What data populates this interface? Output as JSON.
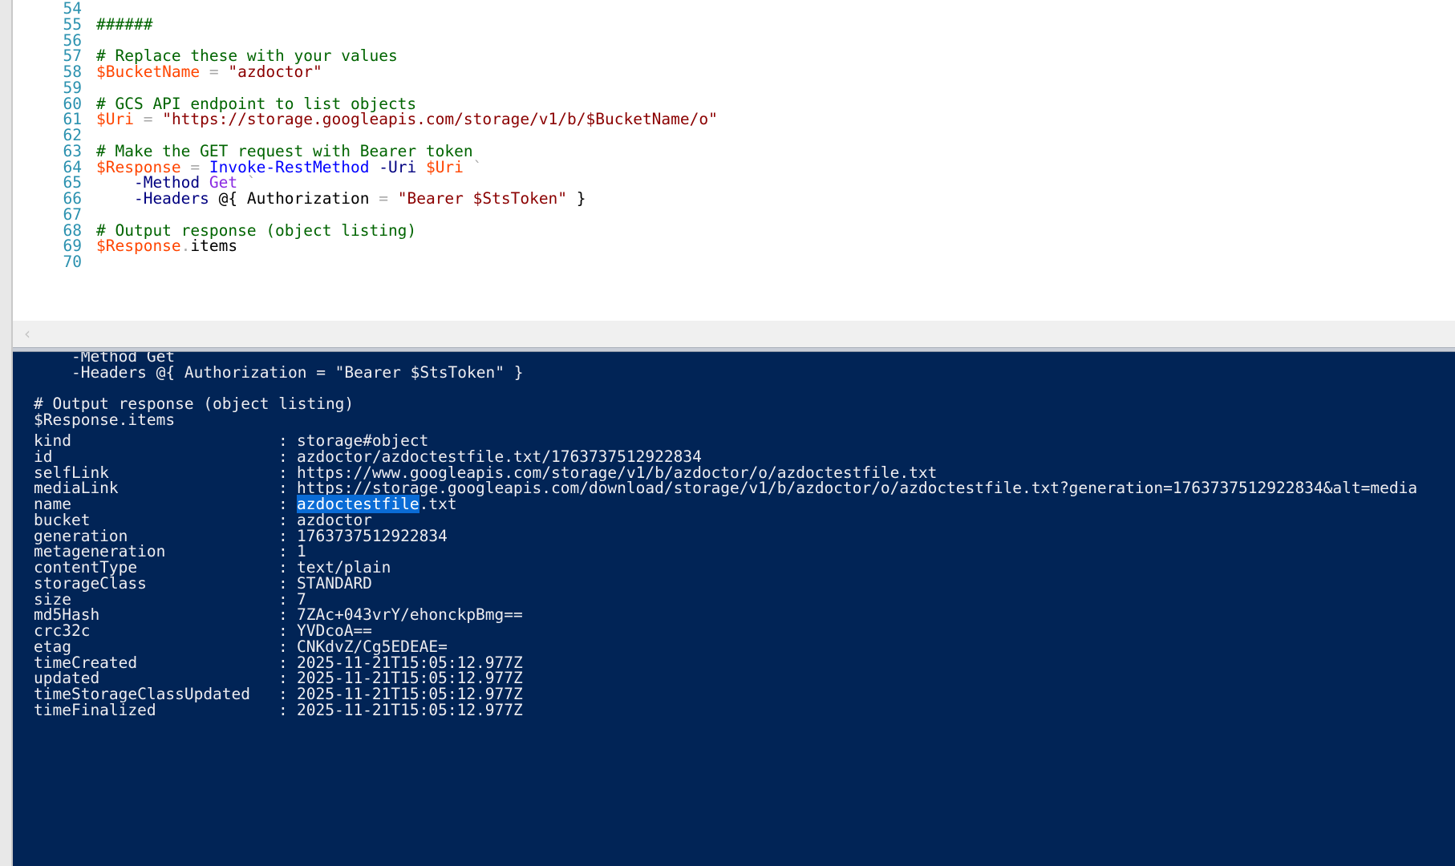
{
  "editor": {
    "line_numbers": [
      "54",
      "55",
      "56",
      "57",
      "58",
      "59",
      "60",
      "61",
      "62",
      "63",
      "64",
      "65",
      "66",
      "67",
      "68",
      "69",
      "70"
    ],
    "lines": [
      [],
      [
        {
          "t": "######",
          "c": "comment"
        }
      ],
      [],
      [
        {
          "t": "# Replace these with your values",
          "c": "comment"
        }
      ],
      [
        {
          "t": "$BucketName",
          "c": "var"
        },
        {
          "t": " = ",
          "c": "op"
        },
        {
          "t": "\"azdoctor\"",
          "c": "string"
        }
      ],
      [],
      [
        {
          "t": "# GCS API endpoint to list objects",
          "c": "comment"
        }
      ],
      [
        {
          "t": "$Uri",
          "c": "var"
        },
        {
          "t": " = ",
          "c": "op"
        },
        {
          "t": "\"https://storage.googleapis.com/storage/v1/b/$BucketName/o\"",
          "c": "string"
        }
      ],
      [],
      [
        {
          "t": "# Make the GET request with Bearer token",
          "c": "comment"
        }
      ],
      [
        {
          "t": "$Response",
          "c": "var"
        },
        {
          "t": " = ",
          "c": "op"
        },
        {
          "t": "Invoke-RestMethod",
          "c": "cmd"
        },
        {
          "t": " -Uri ",
          "c": "param"
        },
        {
          "t": "$Uri",
          "c": "var"
        },
        {
          "t": " `",
          "c": "op"
        }
      ],
      [
        {
          "t": "    -Method ",
          "c": "param"
        },
        {
          "t": "Get",
          "c": "keyword"
        },
        {
          "t": " `",
          "c": "op"
        }
      ],
      [
        {
          "t": "    -Headers ",
          "c": "param"
        },
        {
          "t": "@{ Authorization ",
          "c": "plain"
        },
        {
          "t": "=",
          "c": "op"
        },
        {
          "t": " ",
          "c": "plain"
        },
        {
          "t": "\"Bearer $StsToken\"",
          "c": "string"
        },
        {
          "t": " }",
          "c": "plain"
        }
      ],
      [],
      [
        {
          "t": "# Output response (object listing)",
          "c": "comment"
        }
      ],
      [
        {
          "t": "$Response",
          "c": "var"
        },
        {
          "t": ".",
          "c": "op"
        },
        {
          "t": "items",
          "c": "plain"
        }
      ],
      []
    ]
  },
  "console": {
    "echo_lines": [
      "    -Method Get `",
      "    -Headers @{ Authorization = \"Bearer $StsToken\" }",
      "",
      "# Output response (object listing)",
      "$Response.items"
    ],
    "properties": [
      {
        "name": "kind",
        "value": "storage#object"
      },
      {
        "name": "id",
        "value": "azdoctor/azdoctestfile.txt/1763737512922834"
      },
      {
        "name": "selfLink",
        "value": "https://www.googleapis.com/storage/v1/b/azdoctor/o/azdoctestfile.txt"
      },
      {
        "name": "mediaLink",
        "value": "https://storage.googleapis.com/download/storage/v1/b/azdoctor/o/azdoctestfile.txt?generation=1763737512922834&alt=media"
      },
      {
        "name": "name",
        "value": "azdoctestfile.txt",
        "selected": "azdoctestfile",
        "rest": ".txt"
      },
      {
        "name": "bucket",
        "value": "azdoctor"
      },
      {
        "name": "generation",
        "value": "1763737512922834"
      },
      {
        "name": "metageneration",
        "value": "1"
      },
      {
        "name": "contentType",
        "value": "text/plain"
      },
      {
        "name": "storageClass",
        "value": "STANDARD"
      },
      {
        "name": "size",
        "value": "7"
      },
      {
        "name": "md5Hash",
        "value": "7ZAc+043vrY/ehonckpBmg=="
      },
      {
        "name": "crc32c",
        "value": "YVDcoA=="
      },
      {
        "name": "etag",
        "value": "CNKdvZ/Cg5EDEAE="
      },
      {
        "name": "timeCreated",
        "value": "2025-11-21T15:05:12.977Z"
      },
      {
        "name": "updated",
        "value": "2025-11-21T15:05:12.977Z"
      },
      {
        "name": "timeStorageClassUpdated",
        "value": "2025-11-21T15:05:12.977Z"
      },
      {
        "name": "timeFinalized",
        "value": "2025-11-21T15:05:12.977Z"
      }
    ],
    "separator": ":"
  },
  "scrollbar": {
    "left_arrow": "‹"
  },
  "colors": {
    "console_bg": "#012456",
    "console_fg": "#eeedf0",
    "selection": "#0a6cd6",
    "comment": "#006400",
    "variable": "#ff4500",
    "string": "#8b0000",
    "cmdlet": "#0000ff"
  }
}
